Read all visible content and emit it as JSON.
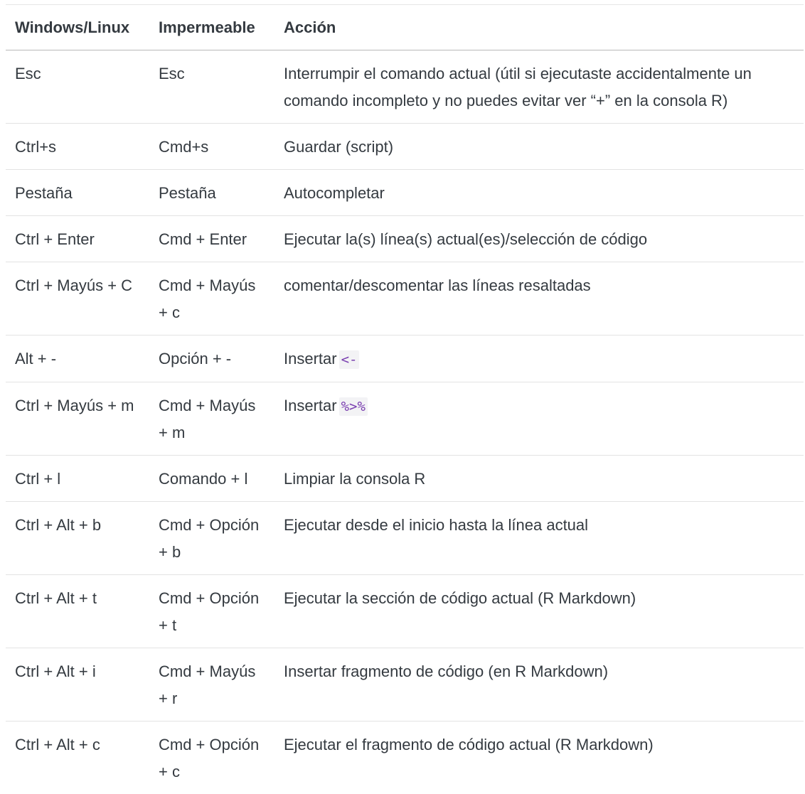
{
  "table": {
    "headers": [
      "Windows/Linux",
      "Impermeable",
      "Acción"
    ],
    "rows": [
      {
        "win": "Esc",
        "mac": "Esc",
        "action": "Interrumpir el comando actual (útil si ejecutaste accidentalmente un comando incompleto y no puedes evitar ver “+” en la consola R)",
        "code": ""
      },
      {
        "win": "Ctrl+s",
        "mac": "Cmd+s",
        "action": "Guardar (script)",
        "code": ""
      },
      {
        "win": "Pestaña",
        "mac": "Pestaña",
        "action": "Autocompletar",
        "code": ""
      },
      {
        "win": "Ctrl + Enter",
        "mac": "Cmd + Enter",
        "action": "Ejecutar la(s) línea(s) actual(es)/selección de código",
        "code": ""
      },
      {
        "win": "Ctrl + Mayús + C",
        "mac": "Cmd + Mayús + c",
        "action": "comentar/descomentar las líneas resaltadas",
        "code": ""
      },
      {
        "win": "Alt + -",
        "mac": "Opción + -",
        "action": "Insertar",
        "code": "<-"
      },
      {
        "win": "Ctrl + Mayús + m",
        "mac": "Cmd + Mayús + m",
        "action": "Insertar",
        "code": "%>%"
      },
      {
        "win": "Ctrl + l",
        "mac": "Comando + l",
        "action": "Limpiar la consola R",
        "code": ""
      },
      {
        "win": "Ctrl + Alt + b",
        "mac": "Cmd + Opción + b",
        "action": "Ejecutar desde el inicio hasta la línea actual",
        "code": ""
      },
      {
        "win": "Ctrl + Alt + t",
        "mac": "Cmd + Opción + t",
        "action": "Ejecutar la sección de código actual (R Markdown)",
        "code": ""
      },
      {
        "win": "Ctrl + Alt + i",
        "mac": "Cmd + Mayús + r",
        "action": "Insertar fragmento de código (en R Markdown)",
        "code": ""
      },
      {
        "win": "Ctrl + Alt + c",
        "mac": "Cmd + Opción + c",
        "action": "Ejecutar el fragmento de código actual (R Markdown)",
        "code": ""
      }
    ]
  }
}
